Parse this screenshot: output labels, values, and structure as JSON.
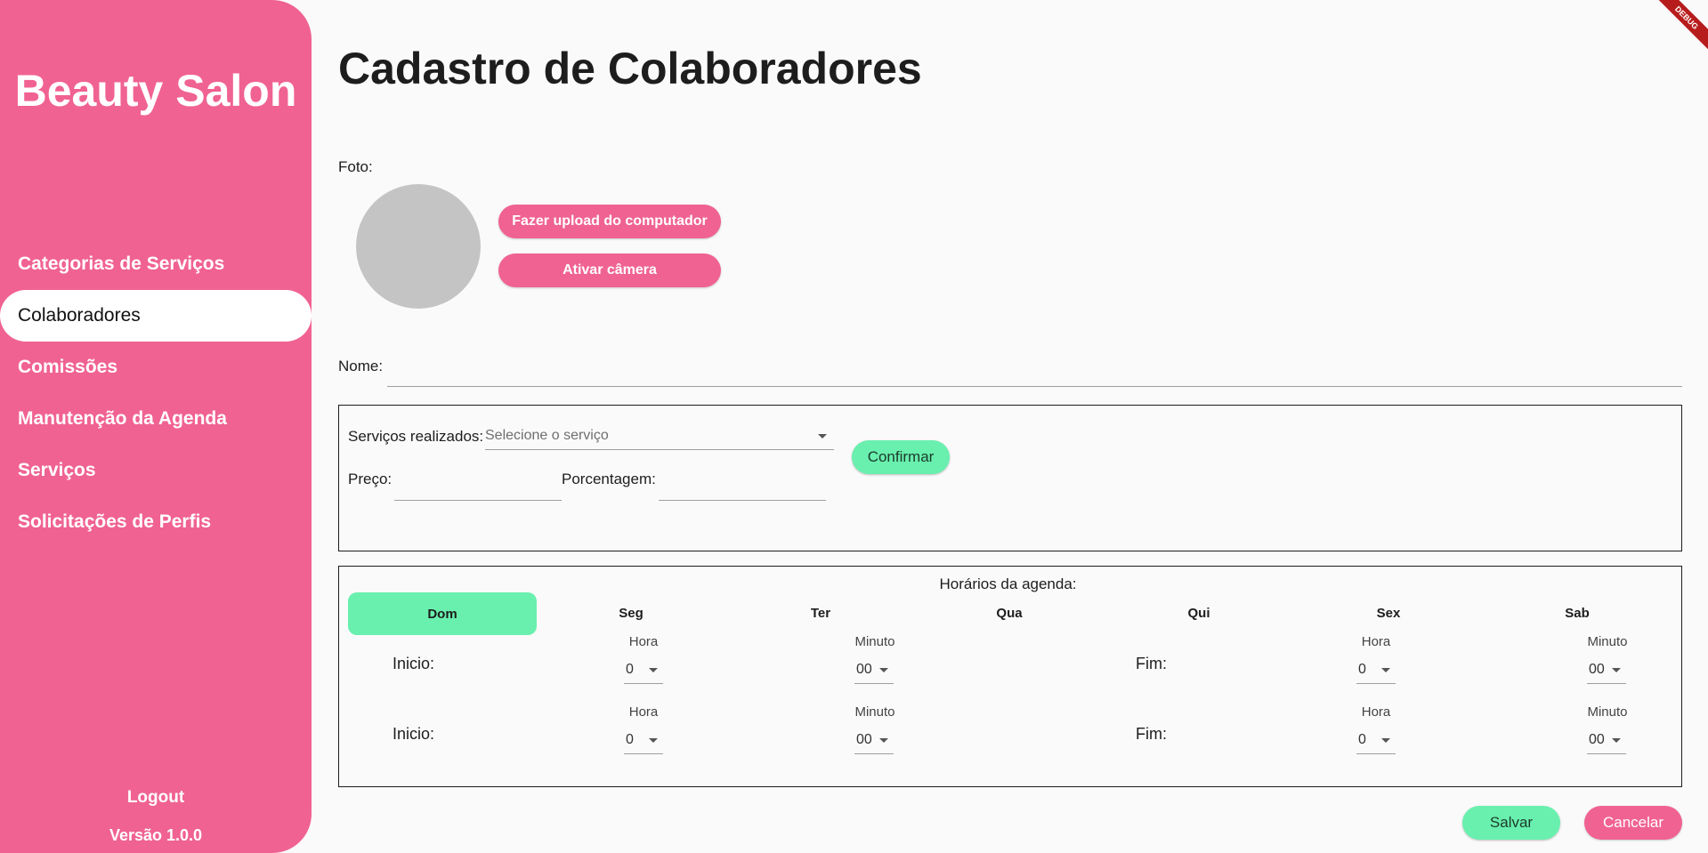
{
  "sidebar": {
    "brand": "Beauty Salon",
    "items": [
      {
        "label": "Categorias de Serviços"
      },
      {
        "label": "Colaboradores"
      },
      {
        "label": "Comissões"
      },
      {
        "label": "Manutenção da Agenda"
      },
      {
        "label": "Serviços"
      },
      {
        "label": "Solicitações de Perfis"
      }
    ],
    "active_item": "Colaboradores",
    "logout": "Logout",
    "version": "Versão 1.0.0"
  },
  "debug_banner": "DEBUG",
  "page_title": "Cadastro de Colaboradores",
  "photo": {
    "label": "Foto:",
    "upload_button": "Fazer upload do computador",
    "camera_button": "Ativar câmera"
  },
  "name_field": {
    "label": "Nome:",
    "value": ""
  },
  "services": {
    "label": "Serviços realizados:",
    "select_placeholder": "Selecione o serviço",
    "price_label": "Preço:",
    "percent_label": "Porcentagem:",
    "confirm_button": "Confirmar"
  },
  "schedule": {
    "title": "Horários da agenda:",
    "days": [
      "Dom",
      "Seg",
      "Ter",
      "Qua",
      "Qui",
      "Sex",
      "Sab"
    ],
    "selected_day": "Dom",
    "rows": [
      {
        "start_label": "Inicio:",
        "end_label": "Fim:",
        "hour_label": "Hora",
        "minute_label": "Minuto",
        "start_hour": "0",
        "start_minute": "00",
        "end_hour": "0",
        "end_minute": "00"
      },
      {
        "start_label": "Inicio:",
        "end_label": "Fim:",
        "hour_label": "Hora",
        "minute_label": "Minuto",
        "start_hour": "0",
        "start_minute": "00",
        "end_hour": "0",
        "end_minute": "00"
      }
    ]
  },
  "actions": {
    "save": "Salvar",
    "cancel": "Cancelar"
  },
  "colors": {
    "primary": "#f06292",
    "accent": "#69f0ae",
    "background": "#fafafa"
  }
}
